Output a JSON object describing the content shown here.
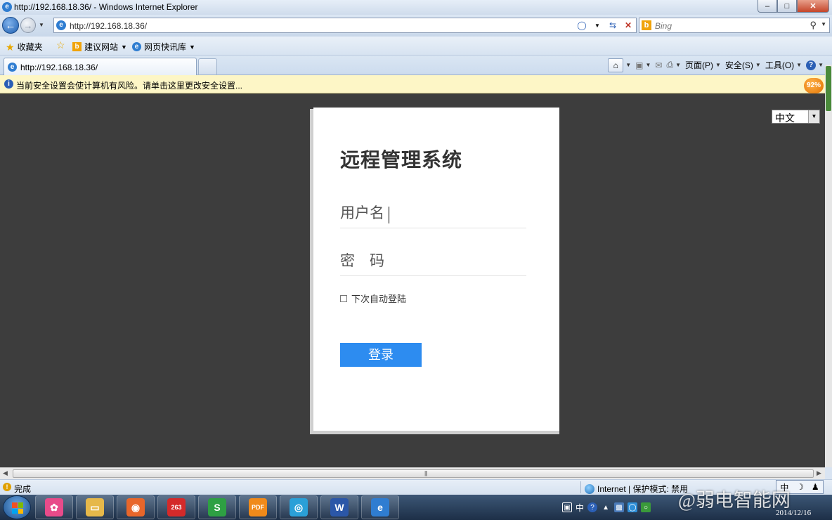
{
  "window": {
    "title": "http://192.168.18.36/ - Windows Internet Explorer",
    "minimize_glyph": "–",
    "maximize_glyph": "□",
    "close_glyph": "✕"
  },
  "address_bar": {
    "url": "http://192.168.18.36/",
    "search_placeholder": "Bing"
  },
  "favorites_bar": {
    "favorites_label": "收藏夹",
    "items": [
      {
        "label": "建议网站",
        "icon": "bing-icon"
      },
      {
        "label": "网页快讯库",
        "icon": "ie-icon"
      }
    ]
  },
  "tabs": [
    {
      "label": "http://192.168.18.36/",
      "active": true
    }
  ],
  "command_bar": {
    "page_label": "页面(P)",
    "safety_label": "安全(S)",
    "tools_label": "工具(O)"
  },
  "info_bar": {
    "text": "当前安全设置会使计算机有风险。请单击这里更改安全设置..."
  },
  "zoom_badge": "92%",
  "language_select": {
    "selected": "中文"
  },
  "login": {
    "title": "远程管理系统",
    "username_placeholder": "用户名",
    "password_placeholder": "密　码",
    "remember_label": "下次自动登陆",
    "submit_label": "登录"
  },
  "status_bar": {
    "status": "完成",
    "zone": "Internet | 保护模式: 禁用"
  },
  "taskbar": {
    "apps": [
      {
        "name": "pinwheel-app-icon",
        "color": "#e84b8a",
        "glyph": "✿"
      },
      {
        "name": "file-explorer-icon",
        "color": "#e6b84a",
        "glyph": "▭"
      },
      {
        "name": "firefox-icon",
        "color": "#e8662a",
        "glyph": "◉"
      },
      {
        "name": "mail-263-icon",
        "color": "#d42a2a",
        "glyph": "263"
      },
      {
        "name": "spreadsheet-app-icon",
        "color": "#2ea043",
        "glyph": "S"
      },
      {
        "name": "pdf-reader-icon",
        "color": "#f08a1a",
        "glyph": "PDF"
      },
      {
        "name": "audio-app-icon",
        "color": "#2aa0d8",
        "glyph": "◎"
      },
      {
        "name": "word-app-icon",
        "color": "#2b57a8",
        "glyph": "W"
      },
      {
        "name": "internet-explorer-icon",
        "color": "#2f7dd1",
        "glyph": "e"
      }
    ],
    "tray_ime": "中",
    "date": "2014/12/16"
  },
  "watermark": "@弱电智能网"
}
